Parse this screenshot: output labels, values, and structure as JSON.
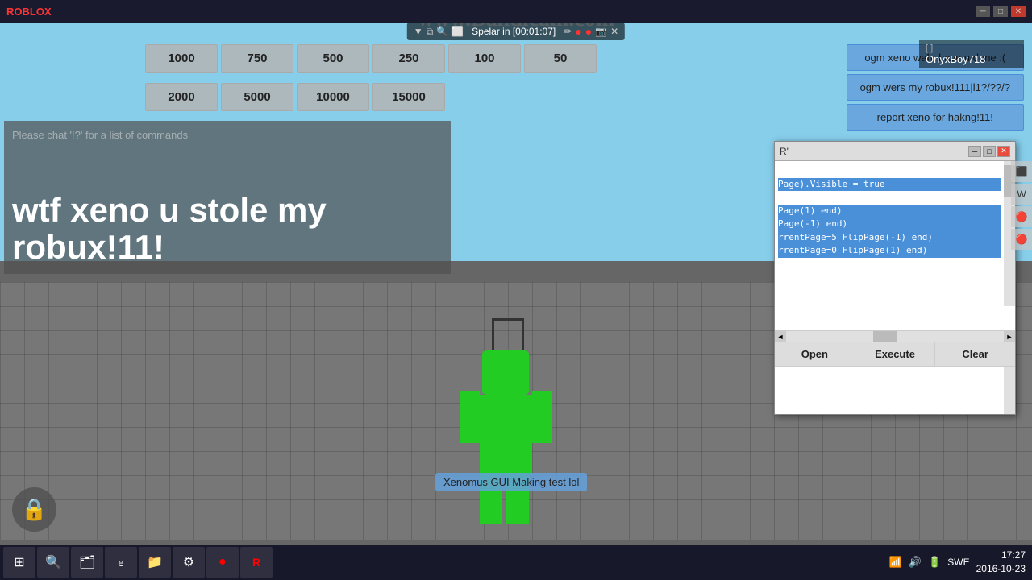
{
  "window": {
    "title": "ROBLOX",
    "watermark": "www.Bandicam.com"
  },
  "toolbar": {
    "timer": "Spelar in [00:01:07]"
  },
  "player": {
    "name": "OnyxBoy718",
    "leaderboard_label": "OnyxBoy718"
  },
  "number_buttons_row1": [
    "1000",
    "750",
    "500",
    "250",
    "100",
    "50"
  ],
  "number_buttons_row2": [
    "2000",
    "5000",
    "10000",
    "15000",
    "",
    ""
  ],
  "chat_buttons": [
    "ogm xeno waht have u done :(",
    "ogm wers my robux!111|l1?/??/?",
    "report xeno for hakng!11!"
  ],
  "chat": {
    "hint": "Please chat '!?' for a list of commands",
    "message": "wtf xeno u stole my robux!11!"
  },
  "character": {
    "label": "Xenomus GUI Making test lol"
  },
  "script_editor": {
    "title": "R'",
    "code_lines": [
      "",
      "Page).Visible = true",
      "",
      "Page(1) end)",
      "Page(-1) end)",
      "rrentPage=5 FlipPage(-1) end)",
      "rrentPage=0 FlipPage(1) end)"
    ],
    "buttons": {
      "open": "Open",
      "execute": "Execute",
      "clear": "Clear"
    }
  },
  "taskbar": {
    "time": "17:27",
    "date": "2016-10-23",
    "language": "SWE",
    "buttons": [
      "⊞",
      "🔍",
      "🗂",
      "e",
      "📁",
      "⚙",
      "●",
      "🎮"
    ]
  }
}
